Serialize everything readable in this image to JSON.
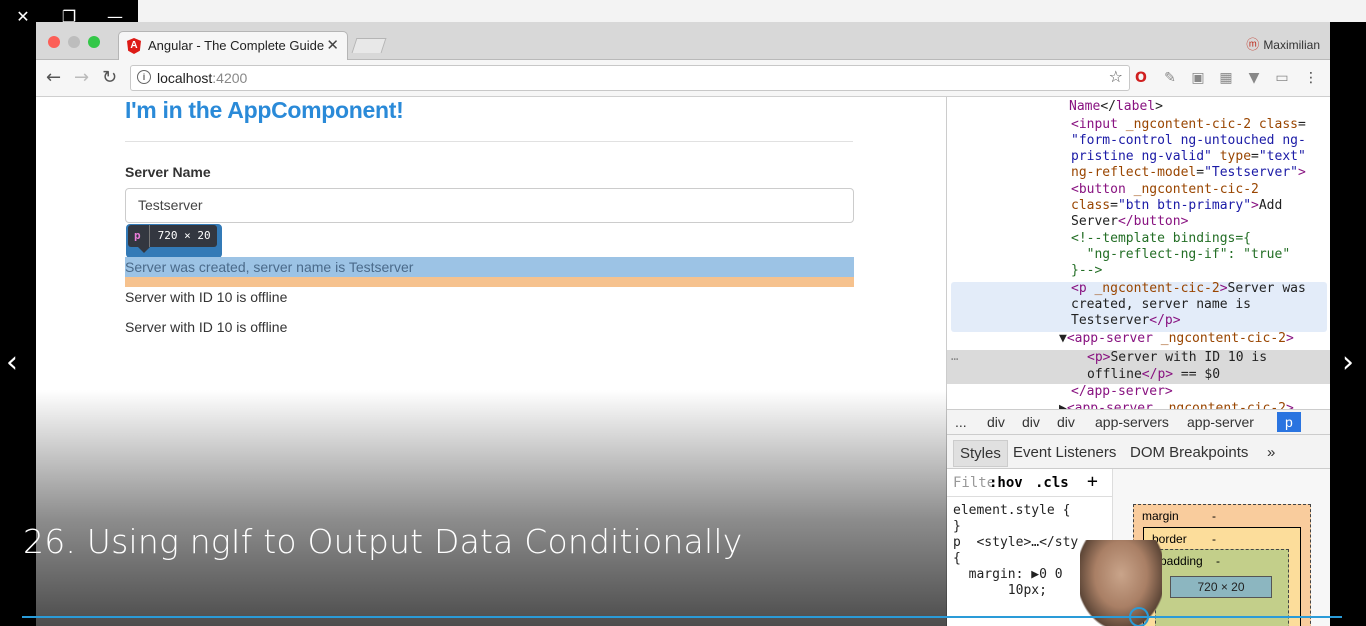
{
  "player": {
    "close_icon": "close-icon",
    "restore_icon": "restore-icon",
    "minimize_icon": "minimize-icon",
    "lecture_title": "26. Using ngIf to Output Data Conditionally",
    "progress_fraction": 0.846
  },
  "browser": {
    "tab_title": "Angular - The Complete Guide",
    "profile_name": "Maximilian",
    "url_host": "localhost",
    "url_port": ":4200"
  },
  "page": {
    "heading": "I'm in the AppComponent!",
    "server_name_label": "Server Name",
    "server_name_value": "Testserver",
    "tooltip_tag": "p",
    "tooltip_size": "720 × 20",
    "created_message": "Server was created, server name is Testserver",
    "servers": [
      "Server with ID 10 is offline",
      "Server with ID 10 is offline"
    ]
  },
  "devtools": {
    "code_lines": [
      {
        "parts": [
          [
            "t",
            "Name"
          ],
          [
            "x",
            "</"
          ],
          [
            "t",
            "label"
          ],
          [
            "x",
            ">"
          ]
        ]
      },
      {
        "parts": [
          [
            "t",
            "<input "
          ],
          [
            "a",
            "_ngcontent-cic-2 "
          ],
          [
            "a",
            "class"
          ],
          [
            "x",
            "="
          ]
        ]
      },
      {
        "parts": [
          [
            "v",
            "\"form-control ng-untouched ng-"
          ]
        ]
      },
      {
        "parts": [
          [
            "v",
            "pristine ng-valid\" "
          ],
          [
            "a",
            "type"
          ],
          [
            "x",
            "="
          ],
          [
            "v",
            "\"text\""
          ]
        ]
      },
      {
        "parts": [
          [
            "a",
            "ng-reflect-model"
          ],
          [
            "x",
            "="
          ],
          [
            "v",
            "\"Testserver\""
          ],
          [
            "t",
            ">"
          ]
        ]
      },
      {
        "parts": [
          [
            "t",
            "<button "
          ],
          [
            "a",
            "_ngcontent-cic-2"
          ]
        ]
      },
      {
        "parts": [
          [
            "a",
            "class"
          ],
          [
            "x",
            "="
          ],
          [
            "v",
            "\"btn btn-primary\""
          ],
          [
            "t",
            ">"
          ],
          [
            "x",
            "Add"
          ]
        ]
      },
      {
        "parts": [
          [
            "x",
            "Server"
          ],
          [
            "t",
            "</button>"
          ]
        ]
      },
      {
        "parts": [
          [
            "c",
            "<!--template bindings={"
          ]
        ]
      },
      {
        "parts": [
          [
            "c",
            "  \"ng-reflect-ng-if\": \"true\""
          ]
        ]
      },
      {
        "parts": [
          [
            "c",
            "}-->"
          ]
        ]
      },
      {
        "parts": [
          [
            "t",
            "<p "
          ],
          [
            "a",
            "_ngcontent-cic-2"
          ],
          [
            "t",
            ">"
          ],
          [
            "x",
            "Server was"
          ]
        ]
      },
      {
        "parts": [
          [
            "x",
            "created, server name is"
          ]
        ]
      },
      {
        "parts": [
          [
            "x",
            "Testserver"
          ],
          [
            "t",
            "</p>"
          ]
        ]
      },
      {
        "parts": [
          [
            "x",
            "▼"
          ],
          [
            "t",
            "<app-server "
          ],
          [
            "a",
            "_ngcontent-cic-2"
          ],
          [
            "t",
            ">"
          ]
        ]
      },
      {
        "parts": [
          [
            "t",
            "<p>"
          ],
          [
            "x",
            "Server with ID 10 is"
          ]
        ]
      },
      {
        "parts": [
          [
            "x",
            "offline"
          ],
          [
            "t",
            "</p>"
          ],
          [
            "x",
            " == $0"
          ]
        ]
      },
      {
        "parts": [
          [
            "t",
            "</app-server>"
          ]
        ]
      },
      {
        "parts": [
          [
            "x",
            "▶"
          ],
          [
            "t",
            "<app-server "
          ],
          [
            "a",
            "_ngcontent-cic-2"
          ],
          [
            "t",
            ">"
          ]
        ]
      }
    ],
    "breadcrumbs": [
      "...",
      "div",
      "div",
      "div",
      "app-servers",
      "app-server",
      "p"
    ],
    "tabs": [
      "Styles",
      "Event Listeners",
      "DOM Breakpoints",
      "»"
    ],
    "filter_placeholder": "Filte",
    "hov_label": ":hov",
    "cls_label": ".cls",
    "add_rule_label": "+",
    "style_lines": [
      "element.style {",
      "}",
      "p  <style>…</sty",
      "{",
      "  margin: ▶0 0",
      "       10px;"
    ],
    "boxmodel": {
      "margin_label": "margin",
      "border_label": "border",
      "padding_label": "padding",
      "dash": "-",
      "content_size": "720 × 20"
    }
  }
}
